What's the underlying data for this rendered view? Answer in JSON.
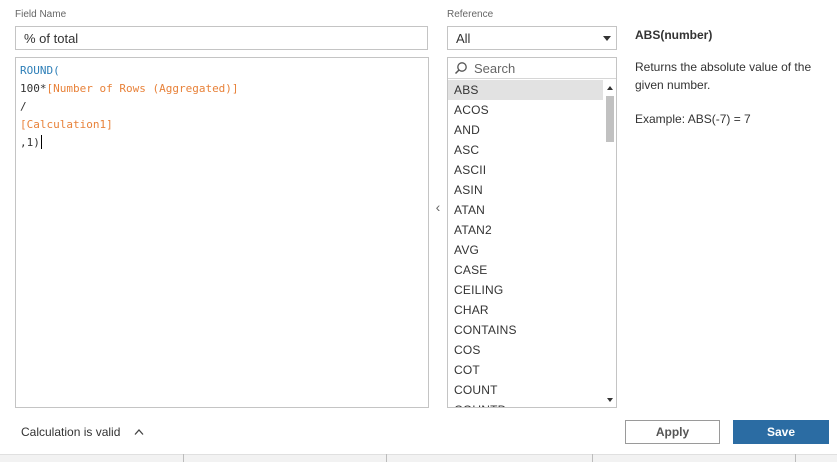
{
  "labels": {
    "field_name": "Field Name",
    "reference": "Reference"
  },
  "field_name_value": "% of total",
  "reference_select": {
    "value": "All"
  },
  "editor": {
    "lines": [
      [
        "ROUND("
      ],
      [
        "100*",
        "[Number of Rows (Aggregated)]"
      ],
      [
        "/"
      ],
      [
        "[Calculation1]"
      ],
      [
        ",1)"
      ]
    ]
  },
  "functions": {
    "search_placeholder": "Search",
    "selected": "ABS",
    "items": [
      "ABS",
      "ACOS",
      "AND",
      "ASC",
      "ASCII",
      "ASIN",
      "ATAN",
      "ATAN2",
      "AVG",
      "CASE",
      "CEILING",
      "CHAR",
      "CONTAINS",
      "COS",
      "COT",
      "COUNT",
      "COUNTD"
    ]
  },
  "help": {
    "title": "ABS(number)",
    "description": "Returns the absolute value of the given number.",
    "example": "Example: ABS(-7) = 7"
  },
  "status": {
    "text": "Calculation is valid"
  },
  "buttons": {
    "apply": "Apply",
    "save": "Save"
  },
  "colors": {
    "keyword": "#2e7fb8",
    "field_ref": "#e8823a",
    "save_button": "#2b6ca3",
    "selected_row": "#e2e2e2"
  },
  "icons": {
    "search": "search-icon",
    "dropdown": "chevron-down-icon",
    "collapse": "chevron-left-icon",
    "status_toggle": "chevron-up-icon"
  }
}
